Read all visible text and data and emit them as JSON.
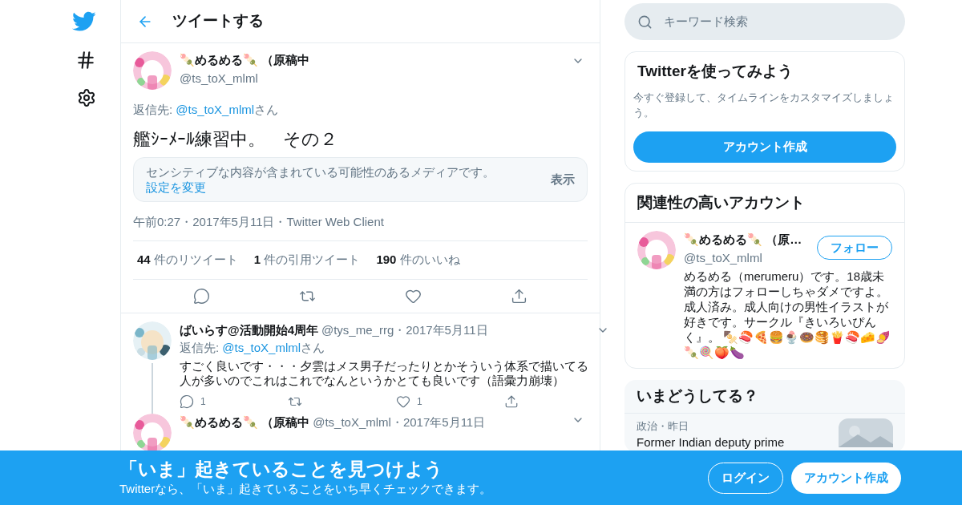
{
  "header": {
    "title": "ツイートする"
  },
  "main_tweet": {
    "name": "🍡めるめる🍡 （原稿中",
    "handle": "@ts_toX_mlml",
    "reply_prefix": "返信先: ",
    "reply_handle": "@ts_toX_mlml",
    "reply_suffix": "さん",
    "text": "艦ｼｰﾒｰﾙ練習中。　その２",
    "sensitive": {
      "text": "センシティブな内容が含まれている可能性のあるメディアです。",
      "link": "設定を変更",
      "action": "表示"
    },
    "meta": "午前0:27・2017年5月11日・Twitter Web Client",
    "stats": [
      {
        "count": "44",
        "label": "件のリツイート"
      },
      {
        "count": "1",
        "label": "件の引用ツイート"
      },
      {
        "count": "190",
        "label": "件のいいね"
      }
    ]
  },
  "replies": [
    {
      "name": "ばいらす@活動開始4周年",
      "meta": "@tys_me_rrg・2017年5月11日",
      "reply_prefix": "返信先: ",
      "reply_handle": "@ts_toX_mlml",
      "reply_suffix": "さん",
      "text": "すごく良いです・・・夕雲はメス男子だったりとかそういう体系で描いてる人が多いのでこれはこれでなんというかとても良いです（語彙力崩壊）",
      "actions": [
        {
          "kind": "reply",
          "count": "1"
        },
        {
          "kind": "retweet"
        },
        {
          "kind": "like",
          "count": "1"
        },
        {
          "kind": "share"
        }
      ]
    },
    {
      "name": "🍡めるめる🍡 （原稿中",
      "meta": "@ts_toX_mlml・2017年5月11日"
    }
  ],
  "search": {
    "placeholder": "キーワード検索"
  },
  "signup_card": {
    "title": "Twitterを使ってみよう",
    "text": "今すぐ登録して、タイムラインをカスタマイズしましょう。",
    "button": "アカウント作成"
  },
  "related": {
    "title": "関連性の高いアカウント",
    "accounts": [
      {
        "name": "🍡めるめる🍡 （原…",
        "handle": "@ts_toX_mlml",
        "button": "フォロー",
        "bio": "めるめる（merumeru）です。18歳未満の方はフォローしちゃダメですよ。成人済み。成人向けの男性イラストが好きです。サークル『きいろいぴんく』。 🍢🍣🍕🍔🍨🍩🥞🍟🍣🧀🍠🍡🍭🍑🍆"
      }
    ]
  },
  "trends": {
    "title": "いまどうしてる？",
    "items": [
      {
        "category": "政治・昨日",
        "text": "Former Indian deputy prime",
        "kind": "picture"
      }
    ]
  },
  "banner": {
    "title": "「いま」起きていることを見つけよう",
    "subtitle": "Twitterなら、「いま」起きていることをいち早くチェックできます。",
    "buttons": [
      {
        "kind": "outline",
        "label": "ログイン"
      },
      {
        "kind": "solid",
        "label": "アカウント作成"
      }
    ]
  }
}
